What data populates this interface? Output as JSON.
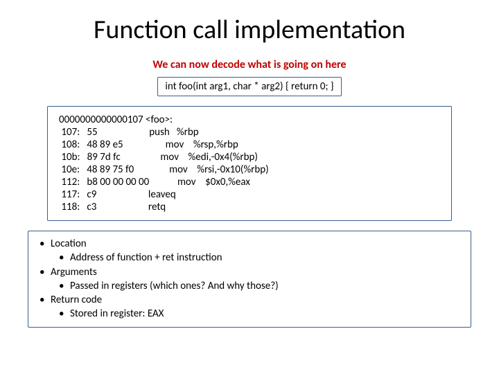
{
  "title": "Function call implementation",
  "subtitle": "We can now decode what is going on here",
  "signature": "int foo(int arg1, char * arg2) { return 0; }",
  "asm": {
    "header": "0000000000000107 <foo>:",
    "lines": [
      " 107:   55                      push   %rbp",
      " 108:   48 89 e5                  mov    %rsp,%rbp",
      " 10b:   89 7d fc                 mov    %edi,-0x4(%rbp)",
      " 10e:   48 89 75 f0               mov    %rsi,-0x10(%rbp)",
      " 112:   b8 00 00 00 00            mov    $0x0,%eax",
      " 117:   c9                      leaveq",
      " 118:   c3                      retq"
    ]
  },
  "notes": [
    {
      "level": 0,
      "text": "Location"
    },
    {
      "level": 1,
      "text": "Address of function + ret instruction"
    },
    {
      "level": 0,
      "text": "Arguments"
    },
    {
      "level": 1,
      "text": "Passed in registers (which ones? And why those?)"
    },
    {
      "level": 0,
      "text": "Return code"
    },
    {
      "level": 1,
      "text": "Stored in register: EAX"
    }
  ]
}
